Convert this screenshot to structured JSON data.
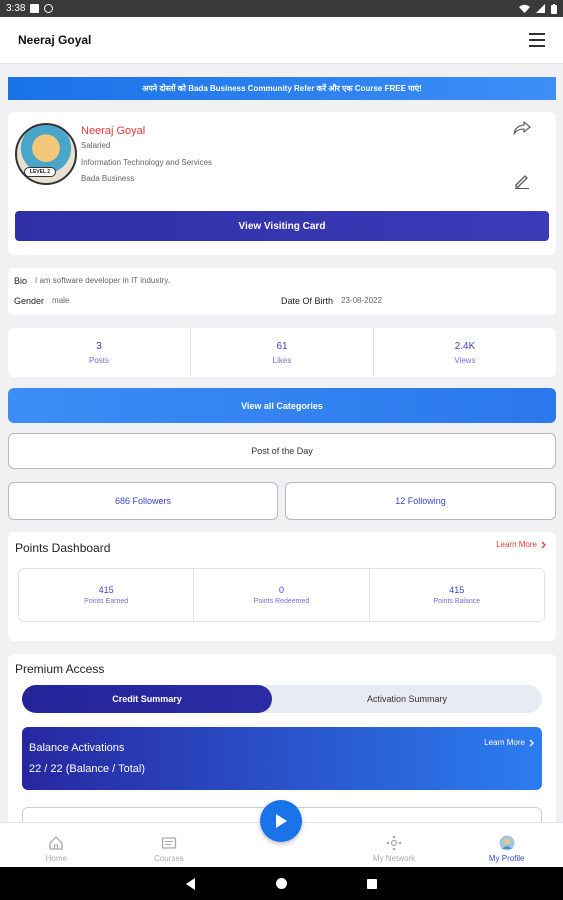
{
  "status_bar": {
    "time": "3:38"
  },
  "app_bar": {
    "title": "Neeraj Goyal",
    "menu_icon": "hamburger-menu-icon"
  },
  "banner": {
    "text": "अपने दोस्तों को Bada Business Community Refer करें और एक Course FREE पाएं!"
  },
  "profile": {
    "name": "Neeraj Goyal",
    "employment": "Salaried",
    "industry": "Information Technology and Services",
    "company": "Bada Business",
    "level_badge": "LEVEL 2",
    "visiting_card_button": "View Visiting Card",
    "share_icon": "share-icon",
    "edit_icon": "edit-pencil-icon"
  },
  "details": {
    "bio_label": "Bio",
    "bio_value": "I am software developer in IT industry.",
    "gender_label": "Gender",
    "gender_value": "male",
    "dob_label": "Date Of Birth",
    "dob_value": "23-08-2022"
  },
  "stats": [
    {
      "value": "3",
      "label": "Posts"
    },
    {
      "value": "61",
      "label": "Likes"
    },
    {
      "value": "2.4K",
      "label": "Views"
    }
  ],
  "categories_button": "View all Categories",
  "post_of_day_button": "Post of the Day",
  "followers_button": "686 Followers",
  "following_button": "12 Following",
  "points": {
    "title": "Points Dashboard",
    "learn_more": "Learn More",
    "items": [
      {
        "value": "415",
        "label": "Points Earned"
      },
      {
        "value": "0",
        "label": "Points Redeemed"
      },
      {
        "value": "415",
        "label": "Points Balance"
      }
    ]
  },
  "premium": {
    "title": "Premium Access",
    "tab_active": "Credit Summary",
    "tab_inactive": "Activation Summary",
    "balance_title": "Balance Activations",
    "balance_value": "22 / 22 (Balance / Total)",
    "learn_more": "Learn More"
  },
  "bottom_nav": [
    {
      "label": "Home",
      "icon": "home-icon",
      "active": false
    },
    {
      "label": "Courses",
      "icon": "courses-icon",
      "active": false
    },
    {
      "label": "My Network",
      "icon": "network-icon",
      "active": false
    },
    {
      "label": "My Profile",
      "icon": "profile-avatar-icon",
      "active": true
    }
  ],
  "colors": {
    "accent": "#3a44c4",
    "brand_blue": "#1a73e8",
    "name_red": "#e53935"
  }
}
